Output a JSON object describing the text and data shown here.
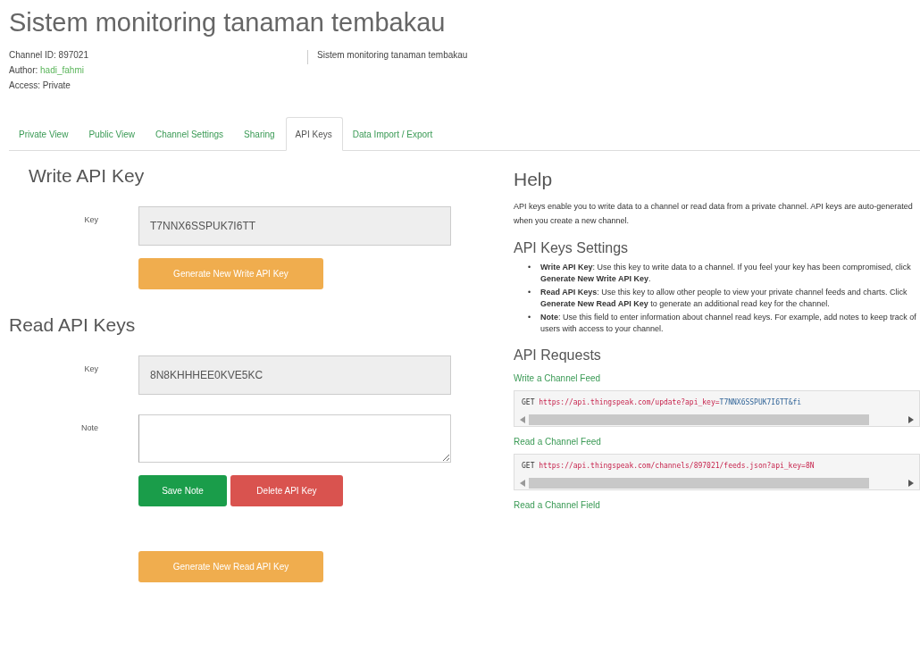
{
  "page_title": "Sistem monitoring tanaman tembakau",
  "channel_info": {
    "channel_id": "Channel ID: 897021",
    "author_label": "Author:",
    "author_link": "hadi_fahmi",
    "access": "Access: Private"
  },
  "description": "Sistem monitoring tanaman tembakau",
  "tabs": [
    {
      "label": "Private View",
      "selected": false
    },
    {
      "label": "Public View",
      "selected": false
    },
    {
      "label": "Channel Settings",
      "selected": false
    },
    {
      "label": "Sharing",
      "selected": false
    },
    {
      "label": "API Keys",
      "selected": true
    },
    {
      "label": "Data Import / Export",
      "selected": false
    }
  ],
  "write_key": {
    "heading": "Write API Key",
    "label": "Key",
    "value": "T7NNX6SSPUK7I6TT",
    "button": "Generate New Write API Key"
  },
  "read_keys": {
    "heading": "Read API Keys",
    "key_label": "Key",
    "key_value": "8N8KHHHEE0KVE5KC",
    "note_label": "Note",
    "save_button": "Save Note",
    "delete_button": "Delete API Key",
    "generate_button": "Generate New Read API Key"
  },
  "help": {
    "heading": "Help",
    "intro": "API keys enable you to write data to a channel or read data from a private channel. API keys are auto-generated when you create a new channel.",
    "settings_heading": "API Keys Settings",
    "settings": [
      {
        "bullet": "•",
        "text": "**Write API Key**: Use this key to write data to a channel. If you feel your key has been compromised, click **Generate New Write API Key**."
      },
      {
        "bullet": "•",
        "text": "**Read API Keys**: Use this key to allow other people to view your private channel feeds and charts. Click **Generate New Read API Key** to generate an additional read key for the channel."
      },
      {
        "bullet": "•",
        "text": "**Note**: Use this field to enter information about channel read keys. For example, add notes to keep track of users with access to your channel."
      }
    ],
    "requests_heading": "API Requests",
    "requests": [
      {
        "title": "Write a Channel Feed",
        "method": "GET",
        "url": "https://api.thingspeak.com/update?api_key=",
        "key": "T7NNX6SSPUK7I6TT&fi"
      },
      {
        "title": "Read a Channel Feed",
        "method": "GET",
        "url": "https://api.thingspeak.com/channels/897021/feeds.json?api_key=8N"
      },
      {
        "title": "Read a Channel Field"
      }
    ]
  }
}
